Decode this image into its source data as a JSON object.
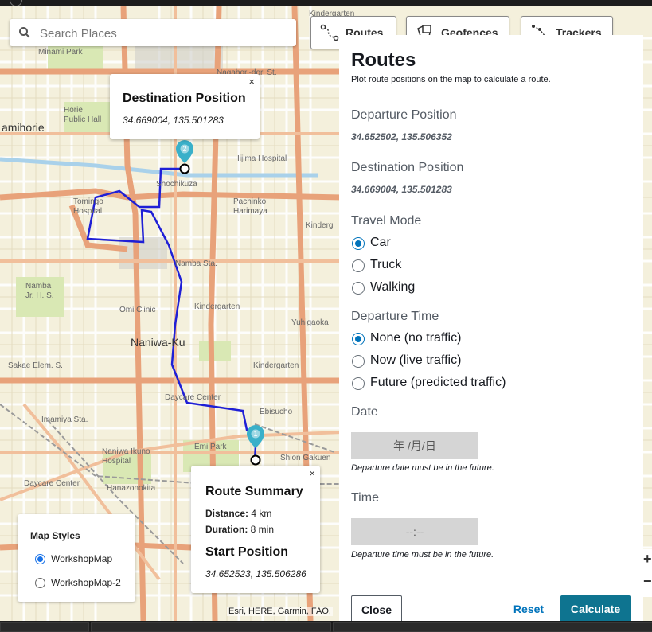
{
  "search": {
    "placeholder": "Search Places"
  },
  "toolbar": {
    "routes_label": "Routes",
    "geofences_label": "Geofences",
    "trackers_label": "Trackers"
  },
  "map": {
    "labels": {
      "minami_park": "Minami Park",
      "nagahori": "Nagahori-dori St.",
      "amihorie": "amihorie",
      "horie_park": "Horie Public Hall",
      "iijima": "Iijima Hospital",
      "shochikuza": "Shochikuza",
      "pachinko": "Pachinko Harimaya",
      "tomingo": "Tomingo Hospital",
      "kinderg1": "Kinderg",
      "namba_sta": "Namba Sta.",
      "namba_jrhs": "Namba Jr. H. S.",
      "omi_clinic": "Omi Clinic",
      "kindergarten1": "Kindergarten",
      "yuhigaoka": "Yuhigaoka",
      "naniwa": "Naniwa-Ku",
      "sakae": "Sakae Elem. S.",
      "kindergarten2": "Kindergarten",
      "daycare1": "Daycare Center",
      "ebisucho": "Ebisucho",
      "imamiya": "Imamiya Sta.",
      "emi_park": "Emi Park",
      "naniwa_ikuno": "Naniwa Ikuno Hospital",
      "shion": "Shion Gakuen",
      "daycare2": "Daycare Center",
      "hanazonokita": "Hanazonokita",
      "kindergarten_top": "Kindergarten"
    },
    "attribution": "Esri, HERE, Garmin, FAO,",
    "route_color": "#1f1fd6",
    "marker_color": "#3ab0c9",
    "marker_dest_num": "2",
    "marker_start_num": "1"
  },
  "dest_popup": {
    "close": "×",
    "title": "Destination Position",
    "coords": "34.669004, 135.501283"
  },
  "summary_popup": {
    "close": "×",
    "title": "Route Summary",
    "distance_label": "Distance:",
    "distance_value": "4 km",
    "duration_label": "Duration:",
    "duration_value": "8 min",
    "start_title": "Start Position",
    "start_coords": "34.652523, 135.506286"
  },
  "map_styles": {
    "title": "Map Styles",
    "options": [
      {
        "label": "WorkshopMap",
        "selected": true
      },
      {
        "label": "WorkshopMap-2",
        "selected": false
      }
    ]
  },
  "panel": {
    "title": "Routes",
    "subtitle": "Plot route positions on the map to calculate a route.",
    "departure_label": "Departure Position",
    "departure_value": "34.652502, 135.506352",
    "destination_label": "Destination Position",
    "destination_value": "34.669004, 135.501283",
    "travel_mode_label": "Travel Mode",
    "travel_modes": [
      {
        "label": "Car",
        "selected": true
      },
      {
        "label": "Truck",
        "selected": false
      },
      {
        "label": "Walking",
        "selected": false
      }
    ],
    "departure_time_label": "Departure Time",
    "departure_times": [
      {
        "label": "None (no traffic)",
        "selected": true
      },
      {
        "label": "Now (live traffic)",
        "selected": false
      },
      {
        "label": "Future (predicted traffic)",
        "selected": false
      }
    ],
    "date_label": "Date",
    "date_placeholder": "年 /月/日",
    "date_hint": "Departure date must be in the future.",
    "time_label": "Time",
    "time_placeholder": "--:--",
    "time_hint": "Departure time must be in the future.",
    "close_button": "Close",
    "reset_button": "Reset",
    "calculate_button": "Calculate"
  },
  "zoom": {
    "in": "+",
    "out": "−"
  }
}
